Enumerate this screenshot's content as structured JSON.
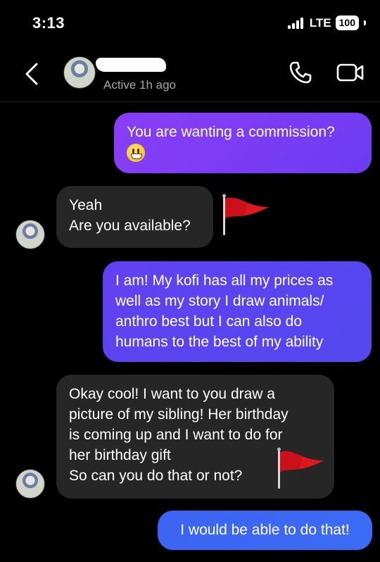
{
  "status_bar": {
    "time": "3:13",
    "network": "LTE",
    "battery": "100"
  },
  "header": {
    "active_status": "Active 1h ago"
  },
  "icons": {
    "back": "chevron-left-icon",
    "call": "phone-icon",
    "video": "video-camera-icon",
    "flag": "red-flag-emoji",
    "emoji": "grinning-face-emoji"
  },
  "messages": [
    {
      "from": "me",
      "lines": [
        "You are wanting a commission?"
      ],
      "emoji": "😃"
    },
    {
      "from": "them",
      "lines": [
        "Yeah",
        "Are you available?"
      ],
      "reaction_flag": true
    },
    {
      "from": "me",
      "lines": [
        "I am! My kofi has all my prices as",
        "well as my story I draw animals/",
        "anthro best but I can also do",
        "humans to the best of my ability"
      ]
    },
    {
      "from": "them",
      "lines": [
        "Okay cool! I want to you draw a",
        "picture of my sibling! Her birthday",
        "is coming up and I want to do for",
        "her birthday gift",
        "So can you do that or not?"
      ],
      "reaction_flag": true
    },
    {
      "from": "me",
      "lines": [
        "I would be able to do that!"
      ]
    }
  ],
  "colors": {
    "sent_purple": "#7b3ff4",
    "sent_violet": "#5945ef",
    "sent_blue": "#3d66f4",
    "received": "#262626",
    "flag_red": "#e0171f"
  }
}
